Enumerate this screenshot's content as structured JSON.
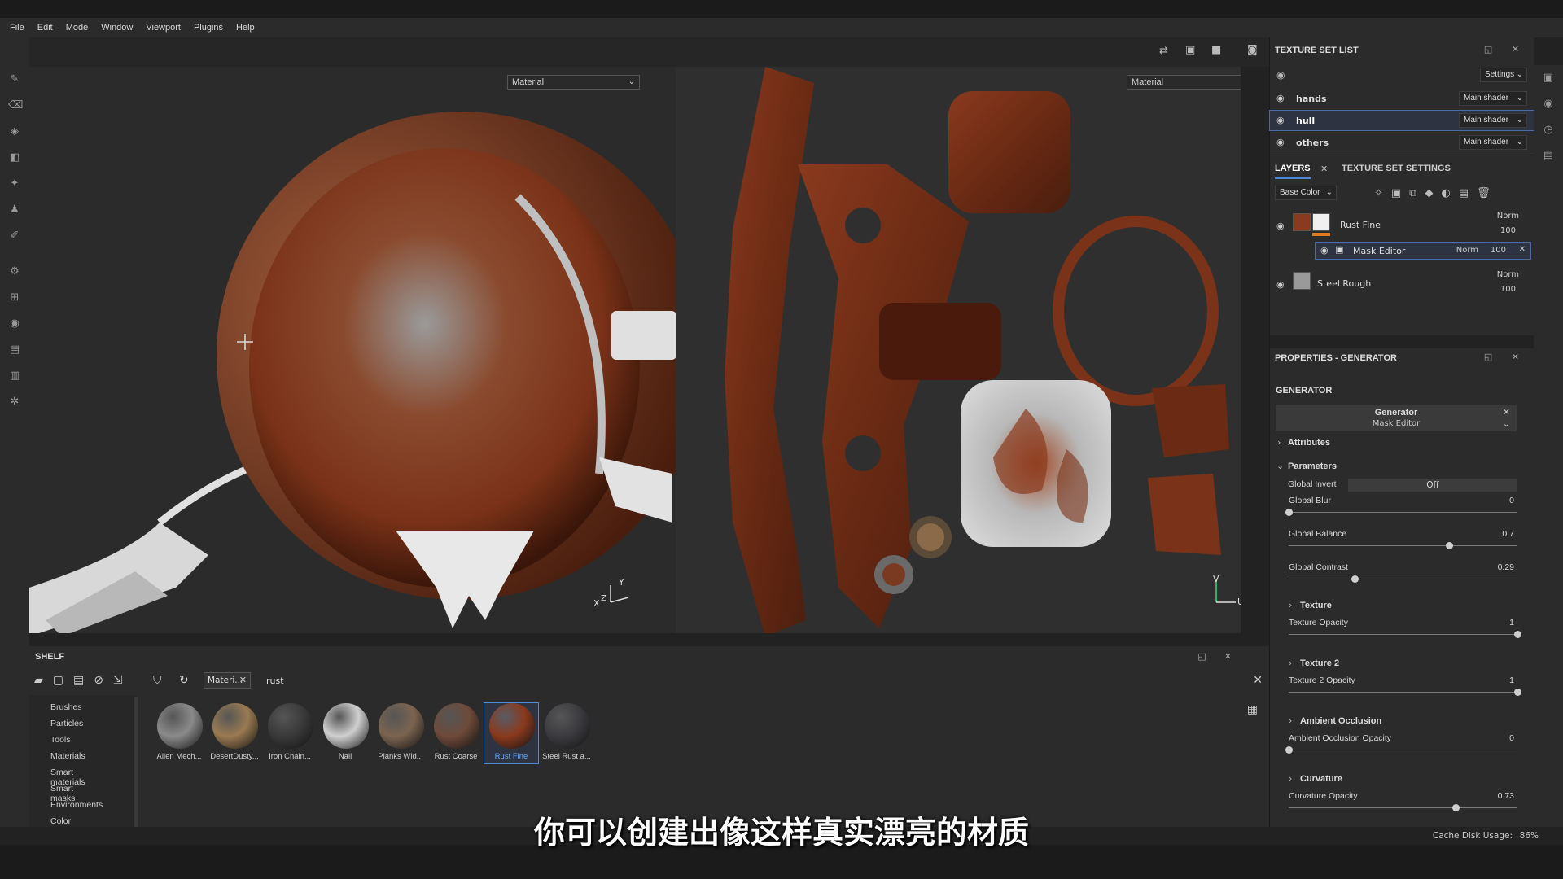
{
  "menu": [
    "File",
    "Edit",
    "Mode",
    "Window",
    "Viewport",
    "Plugins",
    "Help"
  ],
  "viewport3d": {
    "mode": "Material",
    "axis_y": "Y",
    "axis_x": "X",
    "axis_z": "Z"
  },
  "viewport2d": {
    "mode": "Material",
    "axis_v": "V",
    "axis_u": "U"
  },
  "texture_set_list": {
    "title": "TEXTURE SET LIST",
    "settings_label": "Settings",
    "sets": [
      {
        "name": "hands",
        "shader": "Main shader"
      },
      {
        "name": "hull",
        "shader": "Main shader"
      },
      {
        "name": "others",
        "shader": "Main shader"
      }
    ]
  },
  "layers": {
    "tab_layers": "LAYERS",
    "tab_settings": "TEXTURE SET SETTINGS",
    "channel": "Base Color",
    "items": [
      {
        "name": "Rust Fine",
        "blend": "Norm",
        "opacity": "100"
      },
      {
        "name": "Mask Editor",
        "blend": "Norm",
        "opacity": "100"
      },
      {
        "name": "Steel Rough",
        "blend": "Norm",
        "opacity": "100"
      }
    ]
  },
  "properties": {
    "title": "PROPERTIES - GENERATOR",
    "section": "GENERATOR",
    "generator_name": "Generator",
    "generator_sub": "Mask Editor",
    "attributes": "Attributes",
    "parameters": "Parameters",
    "global_invert_label": "Global Invert",
    "global_invert_value": "Off",
    "sliders": [
      {
        "label": "Global Blur",
        "value": "0",
        "fraction": 0.0
      },
      {
        "label": "Global Balance",
        "value": "0.7",
        "fraction": 0.7
      },
      {
        "label": "Global Contrast",
        "value": "0.29",
        "fraction": 0.29
      }
    ],
    "groups": [
      {
        "title": "Texture",
        "label": "Texture Opacity",
        "value": "1",
        "fraction": 1.0
      },
      {
        "title": "Texture 2",
        "label": "Texture 2 Opacity",
        "value": "1",
        "fraction": 1.0
      },
      {
        "title": "Ambient Occlusion",
        "label": "Ambient Occlusion Opacity",
        "value": "0",
        "fraction": 0.0
      },
      {
        "title": "Curvature",
        "label": "Curvature Opacity",
        "value": "0.73",
        "fraction": 0.73
      }
    ]
  },
  "shelf": {
    "title": "SHELF",
    "filter_tag": "Materi...",
    "search": "rust",
    "categories": [
      "Brushes",
      "Particles",
      "Tools",
      "Materials",
      "Smart materials",
      "Smart masks",
      "Environments",
      "Color profiles"
    ],
    "items": [
      {
        "name": "Alien Mech...",
        "color": "#8a8a8a"
      },
      {
        "name": "DesertDusty...",
        "color": "#9a7a52"
      },
      {
        "name": "Iron Chain...",
        "color": "#3a3a3a"
      },
      {
        "name": "Nail",
        "color": "#cfcfcf"
      },
      {
        "name": "Planks Wid...",
        "color": "#7b6450"
      },
      {
        "name": "Rust Coarse",
        "color": "#6e4a3a"
      },
      {
        "name": "Rust Fine",
        "color": "#8a3a1e"
      },
      {
        "name": "Steel Rust a...",
        "color": "#3c3c40"
      }
    ]
  },
  "status": {
    "cache_label": "Cache Disk Usage:",
    "cache_value": "86%"
  },
  "subtitle": "你可以创建出像这样真实漂亮的材质"
}
